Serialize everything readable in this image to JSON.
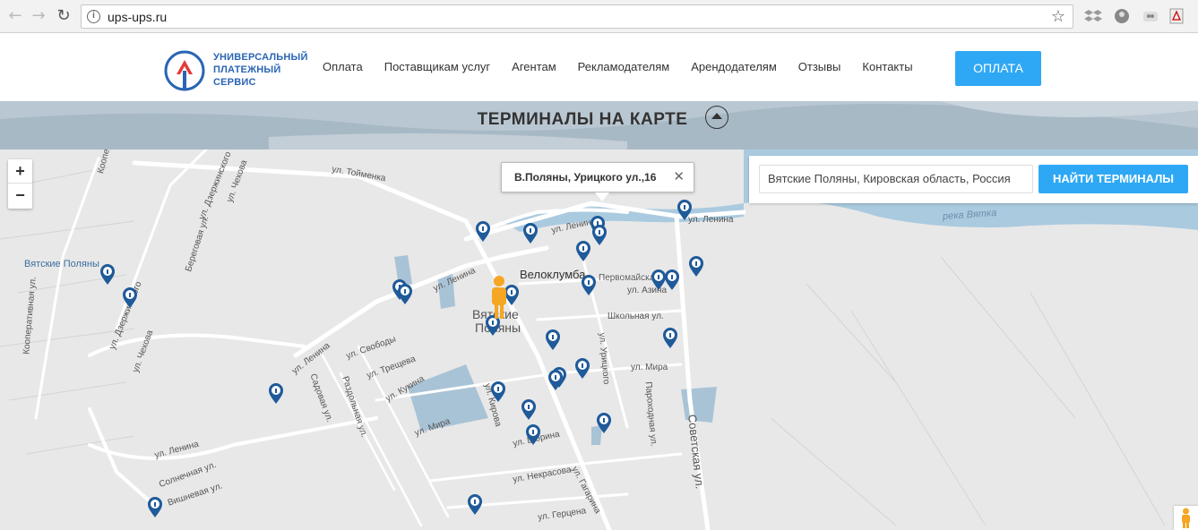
{
  "browser": {
    "url": "ups-ups.ru",
    "back_icon": "arrow-left",
    "forward_icon": "arrow-right",
    "reload_icon": "reload"
  },
  "header": {
    "logo_lines": [
      "УНИВЕРСАЛЬНЫЙ",
      "ПЛАТЕЖНЫЙ",
      "СЕРВИС"
    ],
    "menu": [
      "Оплата",
      "Поставщикам услуг",
      "Агентам",
      "Рекламодателям",
      "Арендодателям",
      "Отзывы",
      "Контакты"
    ],
    "pay_button": "ОПЛАТА",
    "brand_color": "#2ea8f4",
    "logo_color": "#2a65b5"
  },
  "section": {
    "title": "ТЕРМИНАЛЫ НА КАРТЕ"
  },
  "map": {
    "zoom_in": "+",
    "zoom_out": "−",
    "popup_text": "В.Поляны, Урицкого ул.,16",
    "popup_close": "✕",
    "search_value": "Вятские Поляны, Кировская область, Россия",
    "search_button": "НАЙТИ ТЕРМИНАЛЫ",
    "labels": {
      "toymenka": "ул. Тойменка",
      "lenina_top": "ул. Ленина",
      "lenina_right": "ул. Ленина",
      "lenina_mid": "ул. Ленина",
      "lenina_left": "ул. Ленина",
      "lenina_bottom": "ул. Ленина",
      "pervomay": "Первомайская ул.",
      "azina": "ул. Азина",
      "shkolnaya": "Школьная ул.",
      "mira_right": "ул. Мира",
      "mira_left": "ул. Мира",
      "uritskogo": "ул. Урицкого",
      "parohodnaya": "Пароходная ул.",
      "sovetskaya": "Советская ул.",
      "kirova": "ул. Кирова",
      "kukina": "ул. Кукина",
      "trescheva": "ул. Трещева",
      "svobody": "ул. Свободы",
      "sadovaya": "Садовая ул.",
      "razdolnaya": "Раздольная ул.",
      "shorina": "ул. Шорина",
      "nekrasova": "ул. Некрасова",
      "gagarina": "ул. Гагарина",
      "gertsena": "ул. Герцена",
      "solnechnaya": "Солнечная ул.",
      "vishnevaya": "Вишневая ул.",
      "chekhova_top": "ул. Чехова",
      "chekhova_left": "ул. Чехова",
      "dzerzhinskogo_top": "ул. Дзержинского",
      "dzerzhinskogo_left": "ул. Дзержинского",
      "beregovaya": "Береговая ул.",
      "kooperativnaya": "Кооперативная ул.",
      "koopert": "Коопер",
      "vyatka_river": "река Вятка",
      "town_station": "Вятские Поляны",
      "town_name_1": "Вятские",
      "town_name_2": "Поляны",
      "velo": "Велоклумба"
    }
  }
}
